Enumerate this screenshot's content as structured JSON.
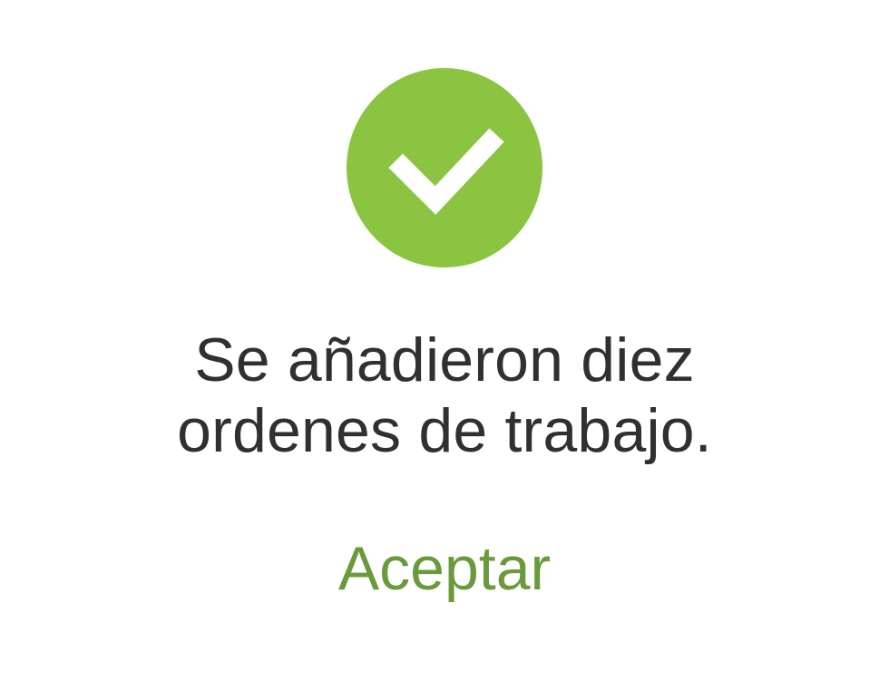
{
  "dialog": {
    "icon": "check-circle-icon",
    "message_line_1": "Se añadieron diez",
    "message_line_2": "ordenes de trabajo.",
    "accept_label": "Aceptar"
  },
  "colors": {
    "success": "#8bc441",
    "text": "#303030",
    "accent": "#6a9a3b",
    "background": "#ffffff"
  }
}
